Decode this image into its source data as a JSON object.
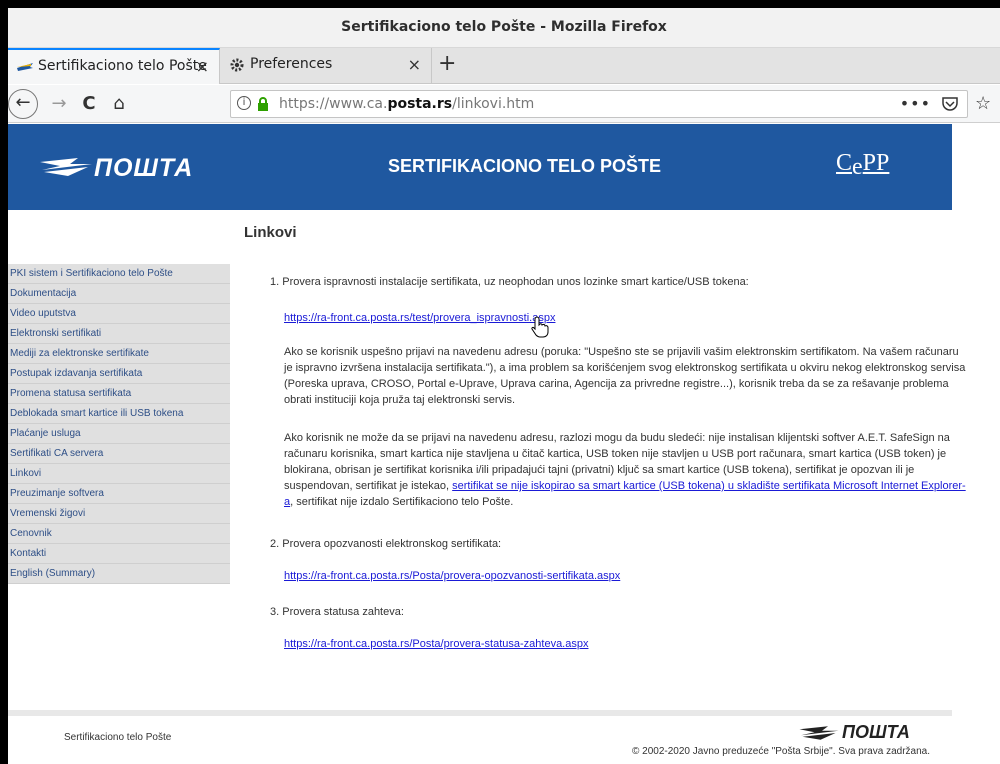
{
  "window": {
    "title": "Sertifikaciono telo Pošte - Mozilla Firefox"
  },
  "tabs": [
    {
      "label": "Sertifikaciono telo Pošte",
      "close": "×"
    },
    {
      "label": "Preferences",
      "close": "×"
    }
  ],
  "newtab": "+",
  "nav": {
    "back": "←",
    "forward": "→",
    "reload": "C",
    "home": "⌂",
    "url_prefix": "https://www.ca.",
    "url_domain": "posta.rs",
    "url_suffix": "/linkovi.htm",
    "more": "•••",
    "star": "☆"
  },
  "colors": {
    "header_bg": "#1f58a0",
    "accent": "#0a84ff",
    "link": "#1a1ad6"
  },
  "site": {
    "logo_text": "ПОШТА",
    "title": "SERTIFIKACIONO TELO POŠTE",
    "cepp_c": "C",
    "cepp_e": "e",
    "cepp_pp": "PP"
  },
  "sidebar": {
    "items": [
      "PKI sistem i Sertifikaciono telo Pošte",
      "Dokumentacija",
      "Video uputstva",
      "Elektronski sertifikati",
      "Mediji za elektronske sertifikate",
      "Postupak izdavanja sertifikata",
      "Promena statusa sertifikata",
      "Deblokada smart kartice ili USB tokena",
      "Plaćanje usluga",
      "Sertifikati CA servera",
      "Linkovi",
      "Preuzimanje softvera",
      "Vremenski žigovi",
      "Cenovnik",
      "Kontakti",
      "English (Summary)"
    ]
  },
  "main": {
    "heading": "Linkovi",
    "item1": "1. Provera ispravnosti instalacije sertifikata, uz neophodan unos lozinke smart kartice/USB tokena:",
    "link1": "https://ra-front.ca.posta.rs/test/provera_ispravnosti.aspx",
    "para1": "Ako se korisnik uspešno prijavi na navedenu adresu (poruka: \"Uspešno ste se prijavili vašim elektronskim sertifikatom. Na vašem računaru je ispravno izvršena instalacija sertifikata.\"), a ima problem sa korišćenjem svog elektronskog sertifikata u okviru nekog elektronskog servisa (Poreska uprava, CROSO, Portal e-Uprave, Uprava carina, Agencija za privredne registre...), korisnik treba da se za rešavanje problema obrati instituciji koja pruža taj elektronski servis.",
    "para2_start": "Ako korisnik ne može da se prijavi na navedenu adresu, razlozi mogu da budu sledeći: nije instalisan klijentski softver A.E.T. SafeSign na računaru korisnika, smart kartica nije stavljena u čitač kartica, USB token nije stavljen u USB port računara, smart kartica (USB token) je blokirana, obrisan je sertifikat korisnika i/ili pripadajući tajni (privatni) ključ sa smart kartice (USB tokena), sertifikat je opozvan ili je suspendovan, sertifikat je istekao, ",
    "para2_link": "sertifikat se nije iskopirao sa smart kartice (USB tokena) u skladište sertifikata Microsoft Internet Explorer-a",
    "para2_end": ", sertifikat nije izdalo Sertifikaciono telo Pošte.",
    "item2": "2. Provera opozvanosti elektronskog sertifikata:",
    "link2": "https://ra-front.ca.posta.rs/Posta/provera-opozvanosti-sertifikata.aspx",
    "item3": "3. Provera statusa zahteva:",
    "link3": "https://ra-front.ca.posta.rs/Posta/provera-statusa-zahteva.aspx"
  },
  "footer": {
    "left": "Sertifikaciono telo Pošte",
    "logo_text": "ПОШТА",
    "copyright": "© 2002-2020 Javno preduzeće \"Pošta Srbije\". Sva prava zadržana."
  }
}
